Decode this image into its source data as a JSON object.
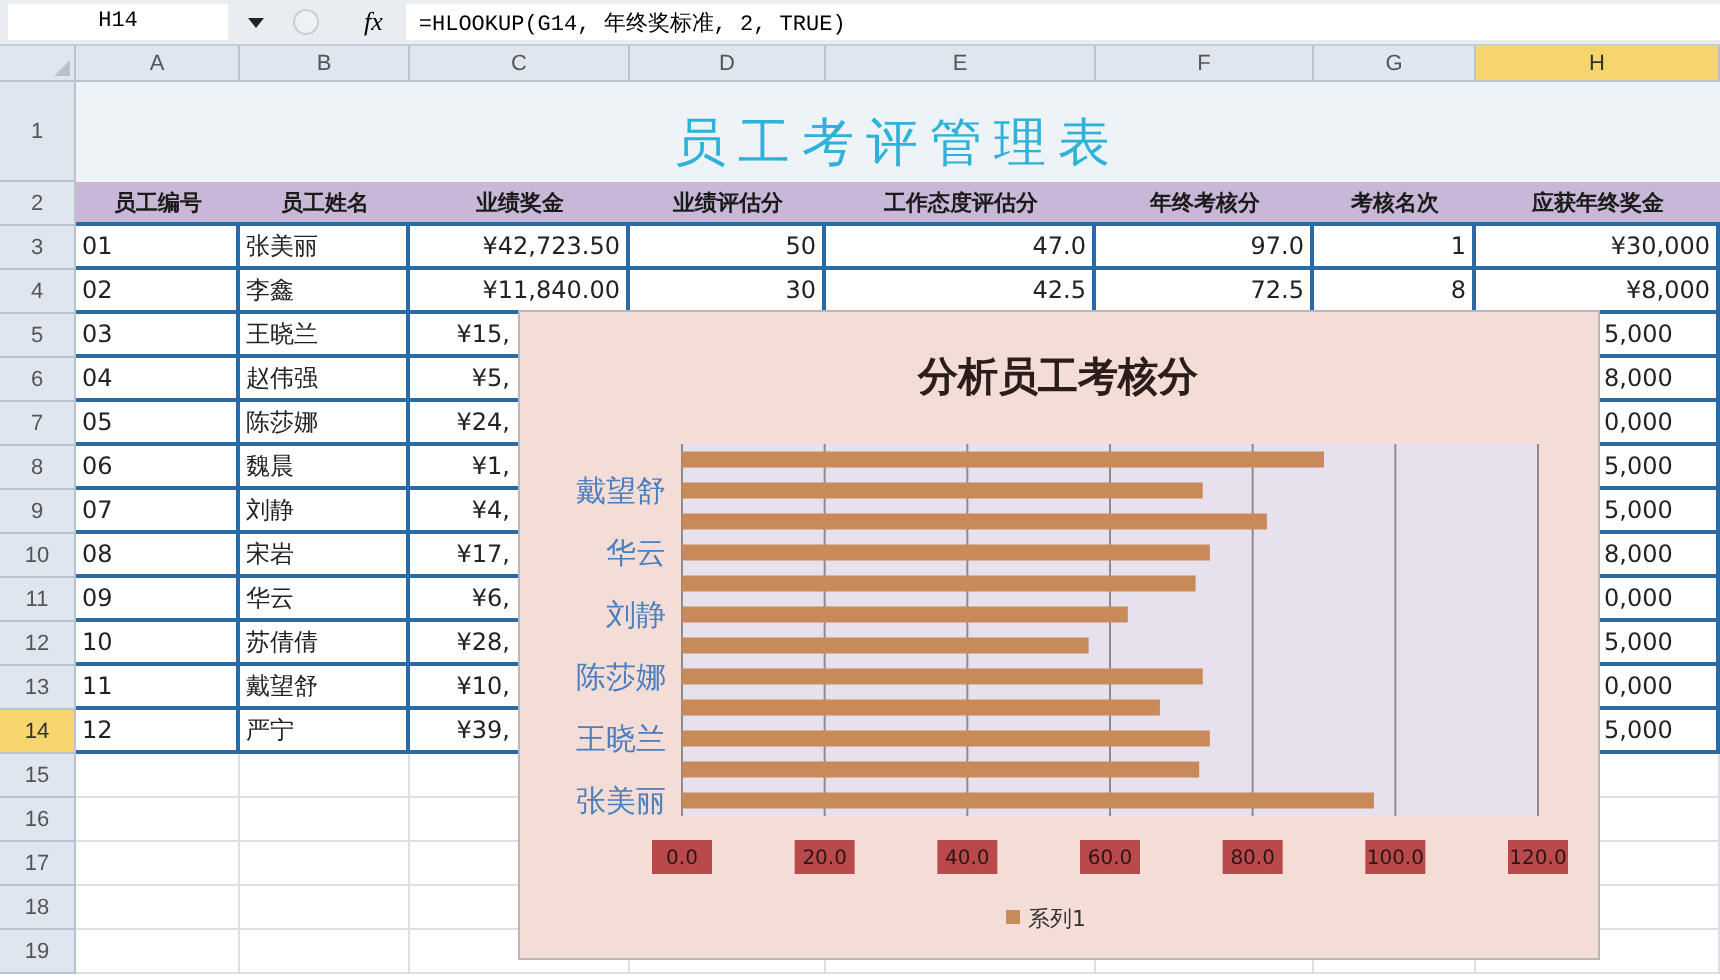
{
  "formula_bar": {
    "name_box": "H14",
    "function_button": "fx",
    "formula": "=HLOOKUP(G14, 年终奖标准, 2, TRUE)"
  },
  "columns": [
    {
      "label": "A",
      "selected": false
    },
    {
      "label": "B",
      "selected": false
    },
    {
      "label": "C",
      "selected": false
    },
    {
      "label": "D",
      "selected": false
    },
    {
      "label": "E",
      "selected": false
    },
    {
      "label": "F",
      "selected": false
    },
    {
      "label": "G",
      "selected": false
    },
    {
      "label": "H",
      "selected": true
    }
  ],
  "row_headers": [
    {
      "label": "1",
      "selected": false
    },
    {
      "label": "2",
      "selected": false
    },
    {
      "label": "3",
      "selected": false
    },
    {
      "label": "4",
      "selected": false
    },
    {
      "label": "5",
      "selected": false
    },
    {
      "label": "6",
      "selected": false
    },
    {
      "label": "7",
      "selected": false
    },
    {
      "label": "8",
      "selected": false
    },
    {
      "label": "9",
      "selected": false
    },
    {
      "label": "10",
      "selected": false
    },
    {
      "label": "11",
      "selected": false
    },
    {
      "label": "12",
      "selected": false
    },
    {
      "label": "13",
      "selected": false
    },
    {
      "label": "14",
      "selected": true
    },
    {
      "label": "15",
      "selected": false
    },
    {
      "label": "16",
      "selected": false
    },
    {
      "label": "17",
      "selected": false
    },
    {
      "label": "18",
      "selected": false
    },
    {
      "label": "19",
      "selected": false
    }
  ],
  "title": "员工考评管理表",
  "header_row": [
    "员工编号",
    "员工姓名",
    "业绩奖金",
    "业绩评估分",
    "工作态度评估分",
    "年终考核分",
    "考核名次",
    "应获年终奖金"
  ],
  "data_rows": [
    {
      "kind": "full",
      "cells": [
        "01",
        "张美丽",
        "¥42,723.50",
        "50",
        "47.0",
        "97.0",
        "1",
        "¥30,000"
      ]
    },
    {
      "kind": "full",
      "cells": [
        "02",
        "李鑫",
        "¥11,840.00",
        "30",
        "42.5",
        "72.5",
        "8",
        "¥8,000"
      ]
    },
    {
      "kind": "covered",
      "cells": [
        "03",
        "王晓兰",
        "¥15,"
      ],
      "tail": "5,000"
    },
    {
      "kind": "covered",
      "cells": [
        "04",
        "赵伟强",
        "¥5,"
      ],
      "tail": "8,000"
    },
    {
      "kind": "covered",
      "cells": [
        "05",
        "陈莎娜",
        "¥24,"
      ],
      "tail": "0,000"
    },
    {
      "kind": "covered",
      "cells": [
        "06",
        "魏晨",
        "¥1,"
      ],
      "tail": "5,000"
    },
    {
      "kind": "covered",
      "cells": [
        "07",
        "刘静",
        "¥4,"
      ],
      "tail": "5,000"
    },
    {
      "kind": "covered",
      "cells": [
        "08",
        "宋岩",
        "¥17,"
      ],
      "tail": "8,000"
    },
    {
      "kind": "covered",
      "cells": [
        "09",
        "华云",
        "¥6,"
      ],
      "tail": "0,000"
    },
    {
      "kind": "covered",
      "cells": [
        "10",
        "苏倩倩",
        "¥28,"
      ],
      "tail": "5,000"
    },
    {
      "kind": "covered",
      "cells": [
        "11",
        "戴望舒",
        "¥10,"
      ],
      "tail": "0,000"
    },
    {
      "kind": "covered",
      "cells": [
        "12",
        "严宁",
        "¥39,"
      ],
      "tail": "5,000"
    }
  ],
  "chart": {
    "chart_data": {
      "type": "bar",
      "orientation": "horizontal",
      "title": "分析员工考核分",
      "categories": [
        null,
        "戴望舒",
        null,
        "华云",
        null,
        "刘静",
        null,
        "陈莎娜",
        null,
        "王晓兰",
        null,
        "张美丽"
      ],
      "series": [
        {
          "name": "系列1",
          "color": "#c98a5a",
          "values": [
            90,
            73,
            82,
            74,
            72,
            62.5,
            57,
            73,
            67,
            74,
            72.5,
            97
          ]
        }
      ],
      "xlim": [
        0,
        120
      ],
      "grid": true,
      "xticks": [
        {
          "value": 0,
          "label": "0.0"
        },
        {
          "value": 20,
          "label": "20.0"
        },
        {
          "value": 40,
          "label": "40.0"
        },
        {
          "value": 60,
          "label": "60.0"
        },
        {
          "value": 80,
          "label": "80.0"
        },
        {
          "value": 100,
          "label": "100.0"
        },
        {
          "value": 120,
          "label": "120.0"
        }
      ]
    }
  }
}
